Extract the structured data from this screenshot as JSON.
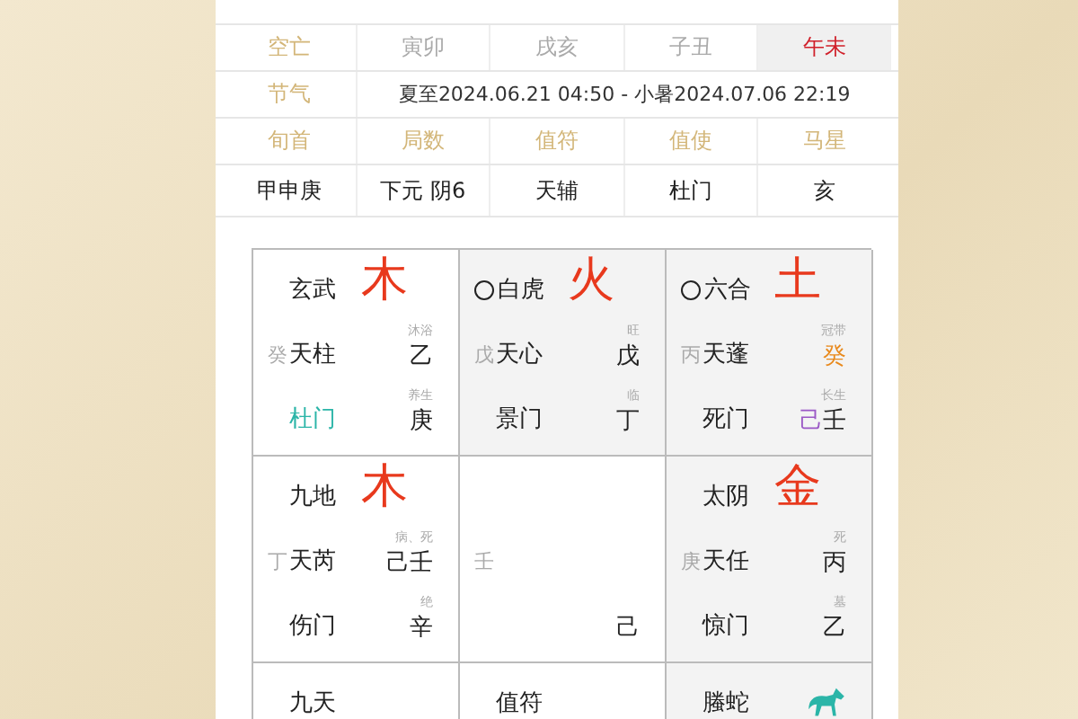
{
  "kongwang": {
    "label": "空亡",
    "values": [
      {
        "text": "寅卯",
        "highlighted": false
      },
      {
        "text": "戌亥",
        "highlighted": false
      },
      {
        "text": "子丑",
        "highlighted": false
      },
      {
        "text": "午未",
        "highlighted": true
      }
    ]
  },
  "jieqi": {
    "label": "节气",
    "value": "夏至2024.06.21 04:50 - 小暑2024.07.06 22:19"
  },
  "headers": [
    "旬首",
    "局数",
    "值符",
    "值使",
    "马星"
  ],
  "values": [
    "甲申庚",
    "下元 阴6",
    "天辅",
    "杜门",
    "亥"
  ],
  "palaces": [
    {
      "shaded": false,
      "empty": false,
      "god": "玄武",
      "left_stem": "癸",
      "star": "天柱",
      "note_top": "沐浴",
      "stem_top": [
        {
          "text": "乙",
          "color": "#222222"
        }
      ],
      "note_bottom": "养生",
      "door": {
        "text": "杜门",
        "color": "#2bb5a8"
      },
      "stem_bottom": [
        {
          "text": "庚",
          "color": "#222222"
        }
      ],
      "element": "木"
    },
    {
      "shaded": true,
      "empty": true,
      "god": "白虎",
      "left_stem": "戊",
      "star": "天心",
      "note_top": "旺",
      "stem_top": [
        {
          "text": "戊",
          "color": "#222222"
        }
      ],
      "note_bottom": "临",
      "door": {
        "text": "景门",
        "color": "#222222"
      },
      "stem_bottom": [
        {
          "text": "丁",
          "color": "#222222"
        }
      ],
      "element": "火"
    },
    {
      "shaded": true,
      "empty": true,
      "god": "六合",
      "left_stem": "丙",
      "star": "天蓬",
      "note_top": "冠带",
      "stem_top": [
        {
          "text": "癸",
          "color": "#e8891c"
        }
      ],
      "note_bottom": "长生",
      "door": {
        "text": "死门",
        "color": "#222222"
      },
      "stem_bottom": [
        {
          "text": "己",
          "color": "#9b59c6"
        },
        {
          "text": "壬",
          "color": "#222222"
        }
      ],
      "element": "土"
    },
    {
      "shaded": false,
      "empty": false,
      "god": "九地",
      "left_stem": "丁",
      "star": "天芮",
      "note_top": "病、死",
      "stem_top": [
        {
          "text": "己",
          "color": "#222222"
        },
        {
          "text": "壬",
          "color": "#222222"
        }
      ],
      "note_bottom": "绝",
      "door": {
        "text": "伤门",
        "color": "#222222"
      },
      "stem_bottom": [
        {
          "text": "辛",
          "color": "#222222"
        }
      ],
      "element": "木"
    },
    {
      "shaded": false,
      "left_stem": "壬",
      "stem_bottom": [
        {
          "text": "己",
          "color": "#222222"
        }
      ]
    },
    {
      "shaded": true,
      "empty": false,
      "god": "太阴",
      "left_stem": "庚",
      "star": "天任",
      "note_top": "死",
      "stem_top": [
        {
          "text": "丙",
          "color": "#222222"
        }
      ],
      "note_bottom": "墓",
      "door": {
        "text": "惊门",
        "color": "#222222"
      },
      "stem_bottom": [
        {
          "text": "乙",
          "color": "#222222"
        }
      ],
      "element": "金"
    },
    {
      "shaded": false,
      "empty": false,
      "god": "九天"
    },
    {
      "shaded": false,
      "empty": false,
      "god": "值符"
    },
    {
      "shaded": true,
      "empty": false,
      "god": "螣蛇",
      "horse": true
    }
  ]
}
